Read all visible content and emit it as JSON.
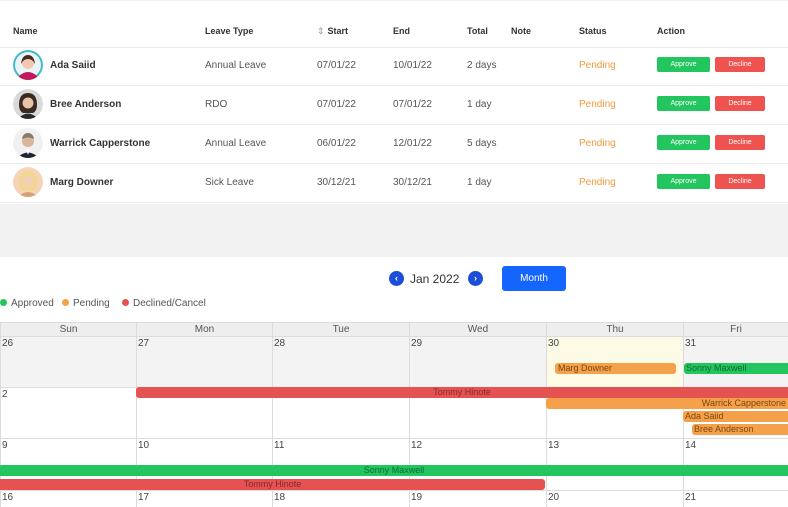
{
  "table": {
    "headers": {
      "name": "Name",
      "leave_type": "Leave Type",
      "start": "Start",
      "end": "End",
      "total": "Total",
      "note": "Note",
      "status": "Status",
      "action": "Action"
    },
    "rows": [
      {
        "name": "Ada Saiid",
        "leave_type": "Annual Leave",
        "start": "07/01/22",
        "end": "10/01/22",
        "total": "2 days",
        "note": "",
        "status": "Pending",
        "approve": "Approve",
        "decline": "Decline"
      },
      {
        "name": "Bree Anderson",
        "leave_type": "RDO",
        "start": "07/01/22",
        "end": "07/01/22",
        "total": "1 day",
        "note": "",
        "status": "Pending",
        "approve": "Approve",
        "decline": "Decline"
      },
      {
        "name": "Warrick Capperstone",
        "leave_type": "Annual Leave",
        "start": "06/01/22",
        "end": "12/01/22",
        "total": "5 days",
        "note": "",
        "status": "Pending",
        "approve": "Approve",
        "decline": "Decline"
      },
      {
        "name": "Marg Downer",
        "leave_type": "Sick Leave",
        "start": "30/12/21",
        "end": "30/12/21",
        "total": "1 day",
        "note": "",
        "status": "Pending",
        "approve": "Approve",
        "decline": "Decline"
      }
    ]
  },
  "calendar": {
    "month_label": "Jan 2022",
    "view_button": "Month",
    "legend": [
      {
        "label": "Approved",
        "color": "#22c55e"
      },
      {
        "label": "Pending",
        "color": "#f5a04a"
      },
      {
        "label": "Declined/Cancel",
        "color": "#e55252"
      }
    ],
    "weekdays": [
      "Sun",
      "Mon",
      "Tue",
      "Wed",
      "Thu",
      "Fri"
    ],
    "weeks": [
      [
        "26",
        "27",
        "28",
        "29",
        "30",
        "31"
      ],
      [
        "2",
        "",
        "",
        "",
        "",
        ""
      ],
      [
        "9",
        "10",
        "11",
        "12",
        "13",
        "14"
      ],
      [
        "16",
        "17",
        "18",
        "19",
        "20",
        "21"
      ]
    ],
    "events": {
      "marg": "Marg Downer",
      "sonny1": "Sonny Maxwell",
      "tommy1": "Tommy Hinote",
      "warrick": "Warrick Capperstone",
      "ada": "Ada Saiid",
      "bree": "Bree Anderson",
      "sonny2": "Sonny Maxwell",
      "tommy2": "Tommy Hinote"
    }
  }
}
